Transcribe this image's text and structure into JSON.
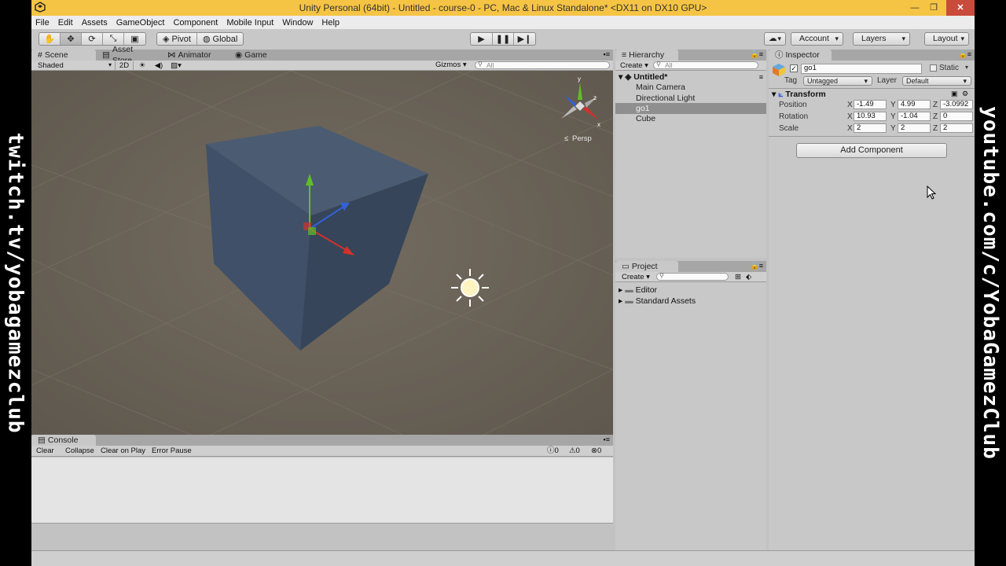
{
  "overlays": {
    "left_text": "twitch.tv/yobagamezclub",
    "right_text": "youtube.com/c/YobaGamezClub"
  },
  "window": {
    "title": "Unity Personal (64bit) - Untitled - course-0 - PC, Mac & Linux Standalone* <DX11 on DX10 GPU>",
    "min_glyph": "—",
    "max_glyph": "❐",
    "close_glyph": "✕"
  },
  "menu": [
    "File",
    "Edit",
    "Assets",
    "GameObject",
    "Component",
    "Mobile Input",
    "Window",
    "Help"
  ],
  "toolbar": {
    "pivot_label": "Pivot",
    "global_label": "Global",
    "account_label": "Account",
    "layers_label": "Layers",
    "layout_label": "Layout"
  },
  "scene": {
    "tabs": [
      "Scene",
      "Asset Store",
      "Animator",
      "Game"
    ],
    "shading_mode": "Shaded",
    "mode_2d": "2D",
    "gizmos_label": "Gizmos",
    "search_placeholder": "All",
    "projection_label": "Persp",
    "gizmo_axes": {
      "x": "x",
      "y": "y",
      "z": "z"
    }
  },
  "console": {
    "tab_label": "Console",
    "buttons": [
      "Clear",
      "Collapse",
      "Clear on Play",
      "Error Pause"
    ],
    "counts": {
      "info": "0",
      "warn": "0",
      "error": "0"
    }
  },
  "hierarchy": {
    "tab_label": "Hierarchy",
    "create_label": "Create",
    "search_placeholder": "All",
    "scene_name": "Untitled*",
    "items": [
      "Main Camera",
      "Directional Light",
      "go1",
      "Cube"
    ],
    "selected_index": 2
  },
  "project": {
    "tab_label": "Project",
    "create_label": "Create",
    "folders": [
      "Editor",
      "Standard Assets"
    ]
  },
  "inspector": {
    "tab_label": "Inspector",
    "object_name": "go1",
    "active": true,
    "static_label": "Static",
    "tag_label": "Tag",
    "tag_value": "Untagged",
    "layer_label": "Layer",
    "layer_value": "Default",
    "component_title": "Transform",
    "rows": [
      {
        "label": "Position",
        "x": "-1.49",
        "y": "4.99",
        "z": "-3.0992"
      },
      {
        "label": "Rotation",
        "x": "10.93",
        "y": "-1.04",
        "z": "0"
      },
      {
        "label": "Scale",
        "x": "2",
        "y": "2",
        "z": "2"
      }
    ],
    "axis_labels": {
      "x": "X",
      "y": "Y",
      "z": "Z"
    },
    "add_component_label": "Add Component"
  },
  "colors": {
    "title_bar": "#f6c445",
    "close_button": "#c94b3b",
    "viewport_bg": "#6a6358",
    "cube_face": "#44546a",
    "axis_x": "#d0322b",
    "axis_y": "#5fbf24",
    "axis_z": "#3461d6"
  }
}
